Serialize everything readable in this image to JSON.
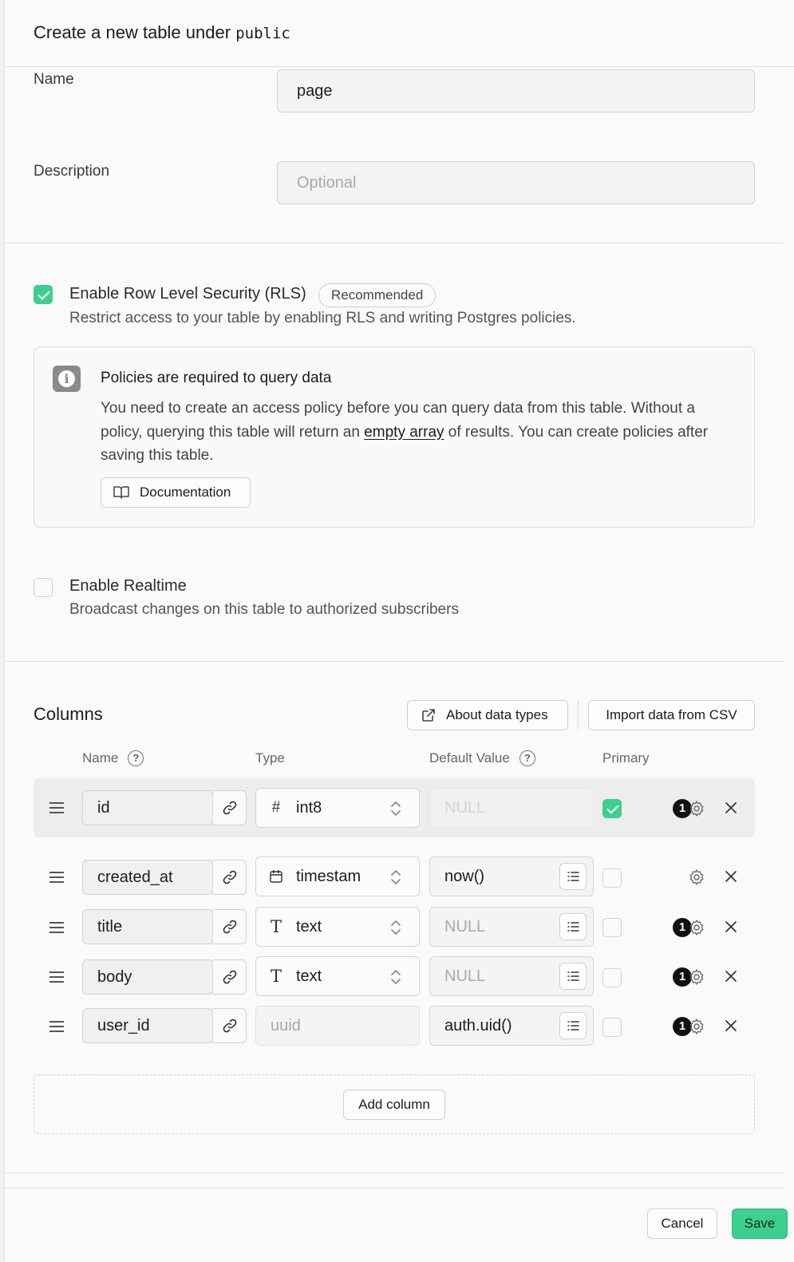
{
  "header": {
    "title_prefix": "Create a new table under",
    "schema": "public"
  },
  "form": {
    "name_label": "Name",
    "name_value": "page",
    "description_label": "Description",
    "description_placeholder": "Optional"
  },
  "rls": {
    "enabled": true,
    "label": "Enable Row Level Security (RLS)",
    "badge": "Recommended",
    "description": "Restrict access to your table by enabling RLS and writing Postgres policies."
  },
  "alert": {
    "title": "Policies are required to query data",
    "body_part1": "You need to create an access policy before you can query data from this table. Without a policy, querying this table will return an",
    "body_link": "empty array",
    "body_part2": "of results. You can create policies after saving this table.",
    "doc_button": "Documentation"
  },
  "realtime": {
    "enabled": false,
    "label": "Enable Realtime",
    "description": "Broadcast changes on this table to authorized subscribers"
  },
  "columns": {
    "title": "Columns",
    "about_button": "About data types",
    "import_button": "Import data from CSV",
    "headers": {
      "name": "Name",
      "type": "Type",
      "default": "Default Value",
      "primary": "Primary"
    },
    "rows": [
      {
        "name": "id",
        "type": "int8",
        "type_icon": "hash-icon",
        "default": "NULL",
        "primary": true,
        "badge": "1"
      },
      {
        "name": "created_at",
        "type": "timestam",
        "type_icon": "calendar-icon",
        "default": "now()",
        "primary": false,
        "badge": ""
      },
      {
        "name": "title",
        "type": "text",
        "type_icon": "text-type-icon",
        "default": "NULL",
        "primary": false,
        "badge": "1"
      },
      {
        "name": "body",
        "type": "text",
        "type_icon": "text-type-icon",
        "default": "NULL",
        "primary": false,
        "badge": "1"
      },
      {
        "name": "user_id",
        "type": "uuid",
        "type_icon": "",
        "default": "auth.uid()",
        "primary": false,
        "badge": "1"
      }
    ],
    "add_button": "Add column"
  },
  "footer": {
    "cancel": "Cancel",
    "save": "Save"
  },
  "colors": {
    "accent": "#3ecf8e",
    "accent_border": "#2fb47a"
  }
}
